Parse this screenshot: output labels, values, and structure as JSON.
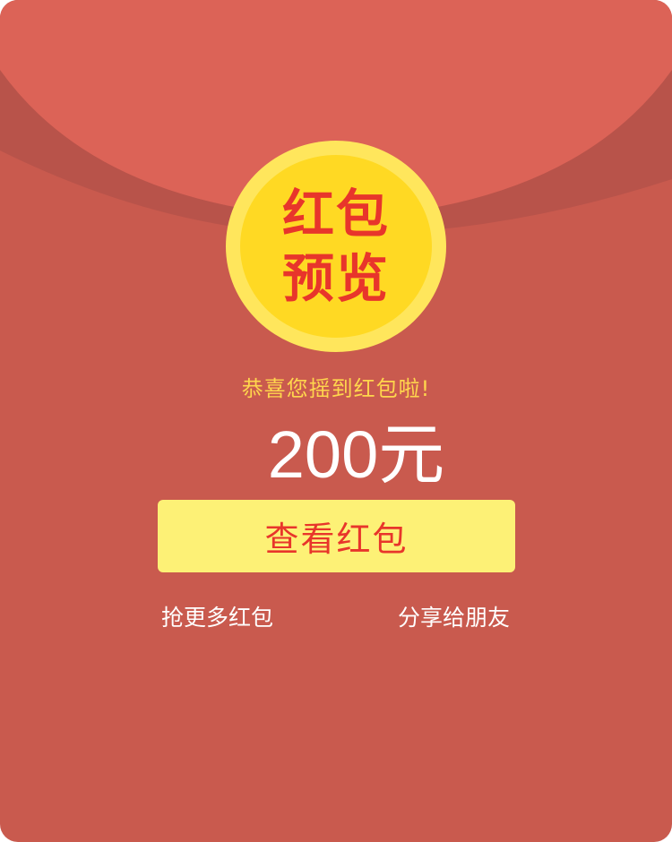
{
  "colors": {
    "envelope_body": "#c95a4e",
    "envelope_flap": "#dc6357",
    "flap_shadow": "#b8534a",
    "coin_rim": "#ffe65c",
    "coin_face": "#ffd923",
    "coin_text": "#e8352b",
    "congrats_text": "#ffd64d",
    "button_bg": "#fdf176",
    "button_text": "#e8352b",
    "link_text": "#ffffff"
  },
  "coin": {
    "line1": "红包",
    "line2": "预览"
  },
  "congrats": "恭喜您摇到红包啦!",
  "amount": "200元",
  "view_button": "查看红包",
  "links": {
    "grab_more": "抢更多红包",
    "share": "分享给朋友"
  }
}
